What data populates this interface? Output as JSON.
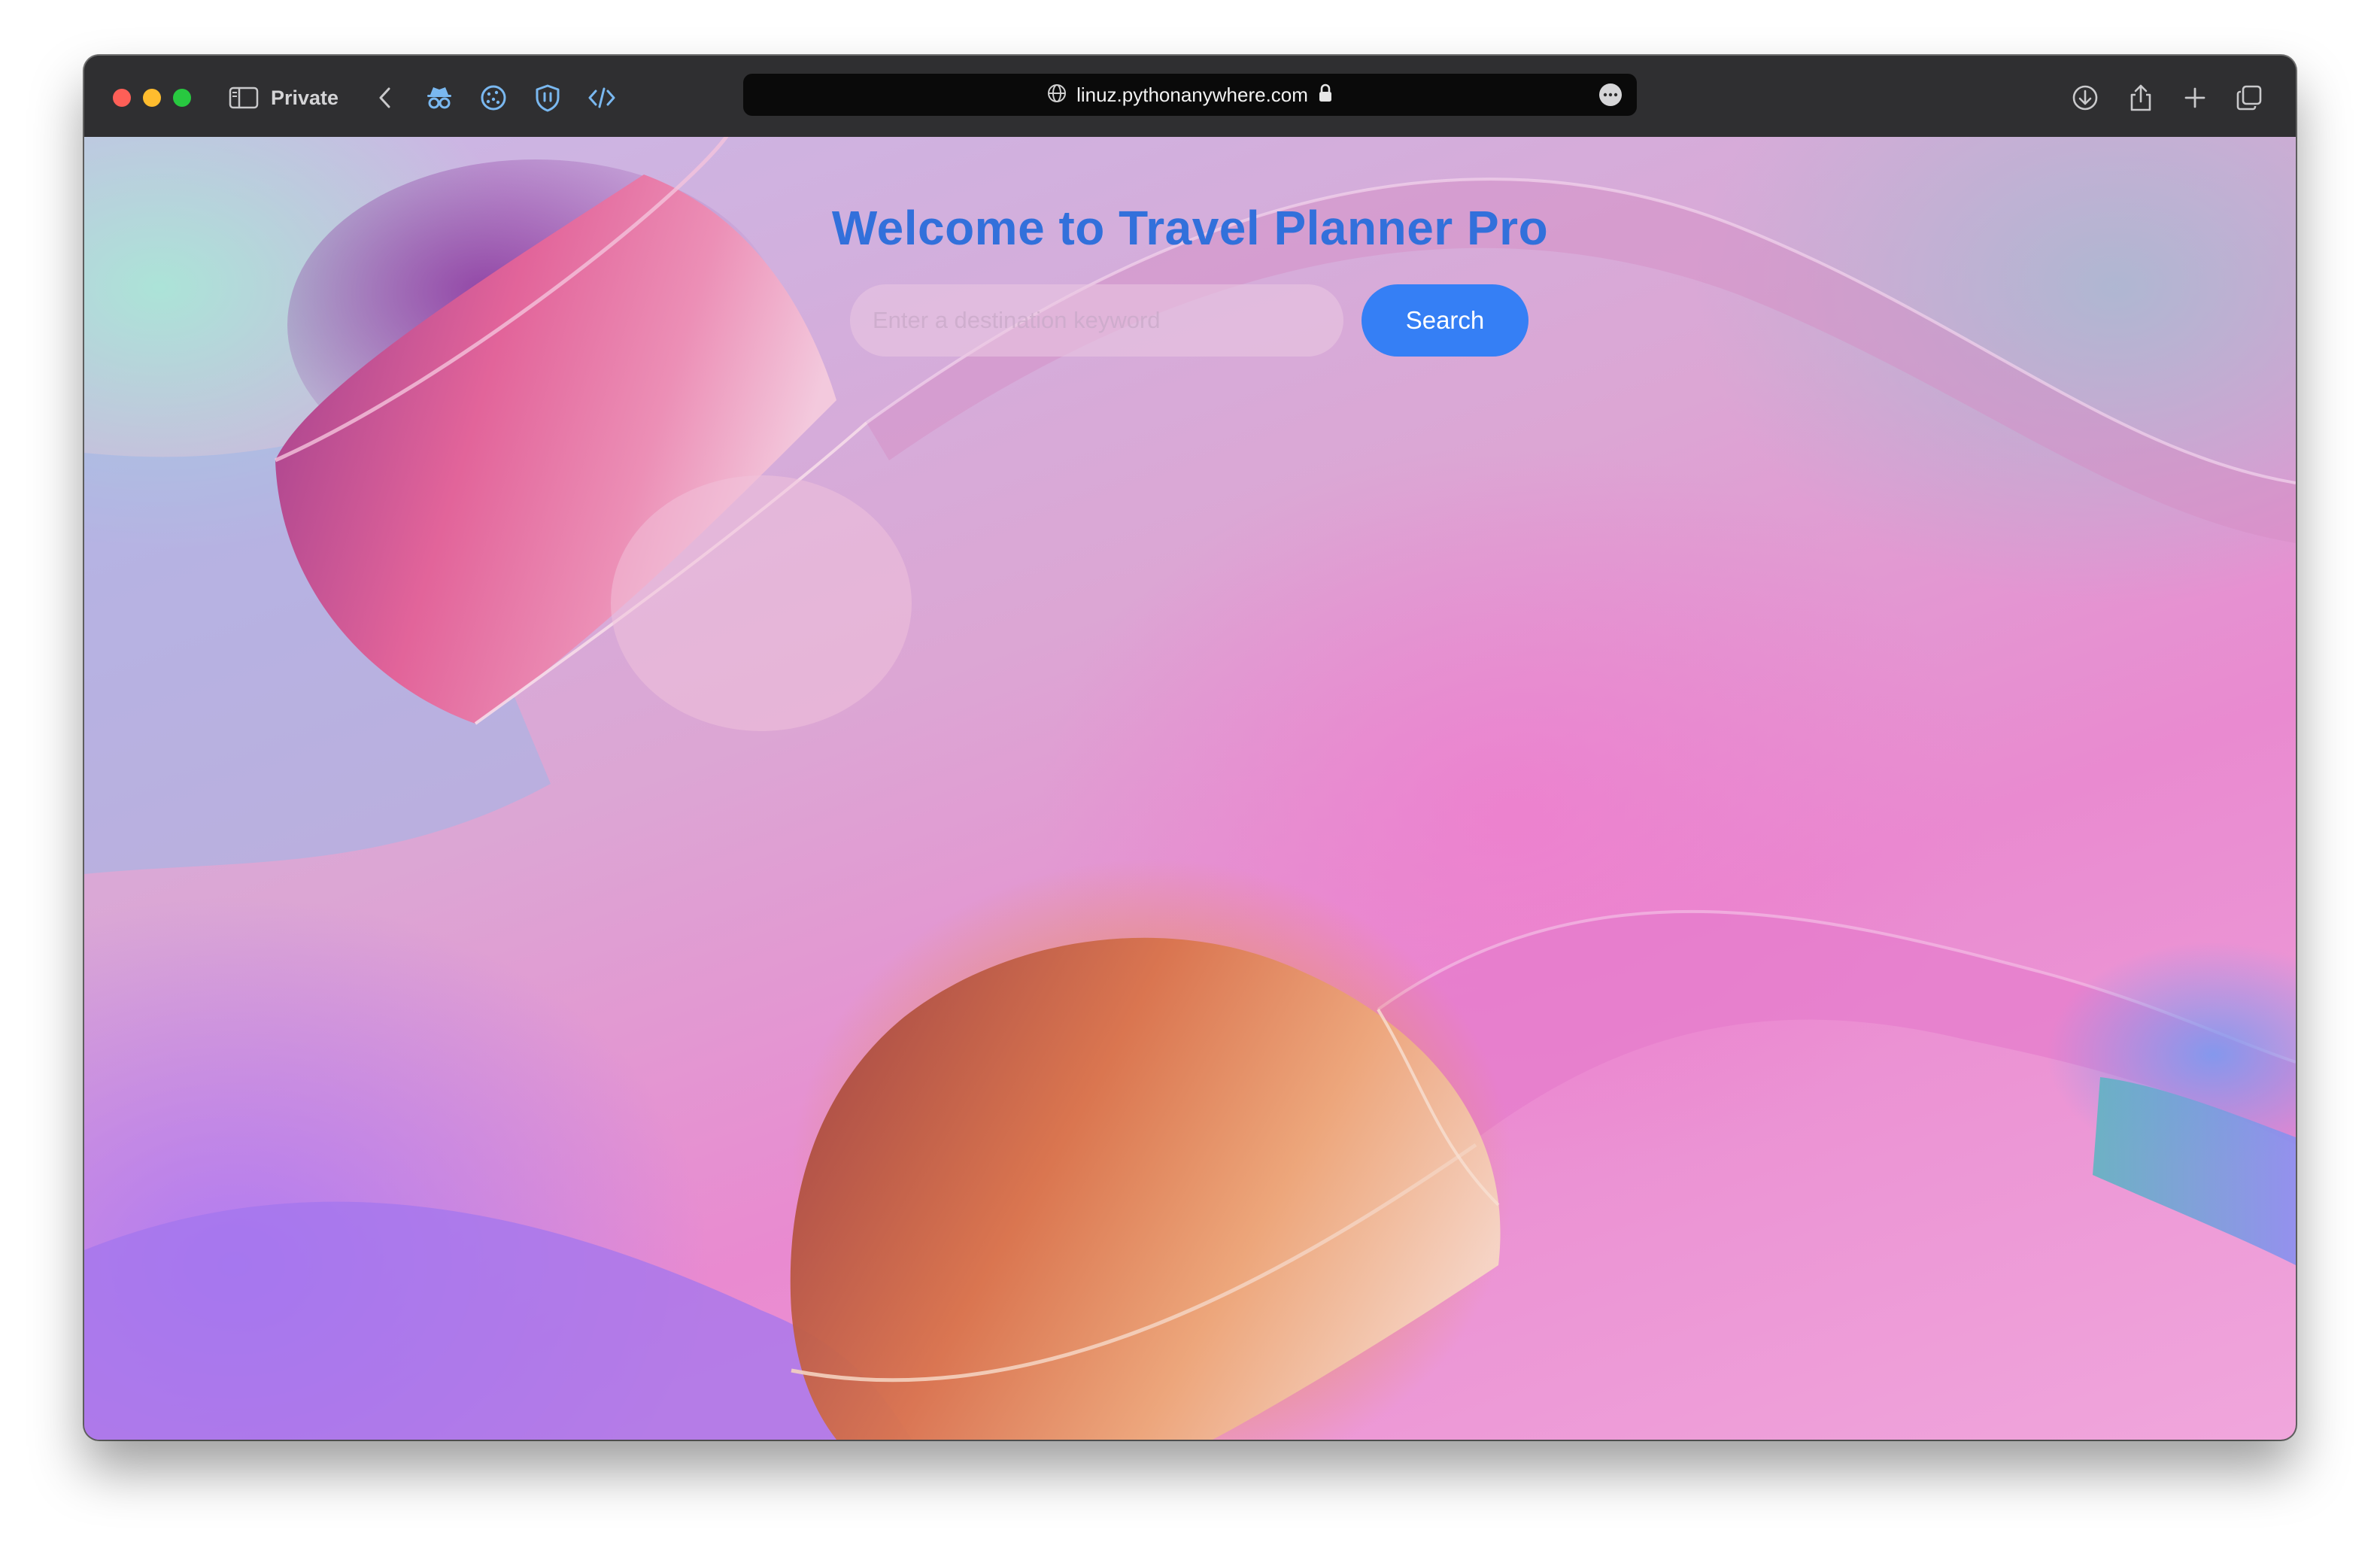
{
  "browser": {
    "mode_label": "Private",
    "url": "linuz.pythonanywhere.com",
    "toolbar_icons": [
      "sidebar-icon",
      "back-icon",
      "incognito-extension-icon",
      "cookie-extension-icon",
      "shield-extension-icon",
      "code-extension-icon",
      "page-menu-icon",
      "download-icon",
      "share-icon",
      "new-tab-icon",
      "tab-overview-icon"
    ]
  },
  "page": {
    "title": "Welcome to Travel Planner Pro",
    "search": {
      "placeholder": "Enter a destination keyword",
      "value": ""
    },
    "search_button_label": "Search"
  },
  "colors": {
    "title": "#3270db",
    "button": "#357ff5",
    "toolbar": "#2f2f31"
  }
}
